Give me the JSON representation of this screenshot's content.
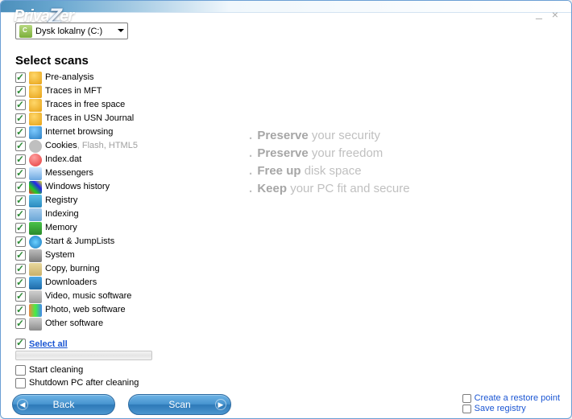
{
  "app": {
    "name": "PrivaZer"
  },
  "drive": {
    "label": "Dysk lokalny (C:)"
  },
  "section_title": "Select scans",
  "scans": [
    {
      "label": "Pre-analysis",
      "checked": true,
      "icon": "ico-shield"
    },
    {
      "label": "Traces in MFT",
      "checked": true,
      "icon": "ico-shield"
    },
    {
      "label": "Traces in free space",
      "checked": true,
      "icon": "ico-shield"
    },
    {
      "label": "Traces in USN Journal",
      "checked": true,
      "icon": "ico-shield"
    },
    {
      "label": "Internet browsing",
      "checked": true,
      "icon": "ico-globe"
    },
    {
      "label": "Cookies",
      "label_muted": ", Flash, HTML5",
      "checked": true,
      "icon": "ico-cookie"
    },
    {
      "label": "Index.dat",
      "checked": true,
      "icon": "ico-index"
    },
    {
      "label": "Messengers",
      "checked": true,
      "icon": "ico-msg"
    },
    {
      "label": "Windows history",
      "checked": true,
      "icon": "ico-win"
    },
    {
      "label": "Registry",
      "checked": true,
      "icon": "ico-reg"
    },
    {
      "label": "Indexing",
      "checked": true,
      "icon": "ico-idx"
    },
    {
      "label": "Memory",
      "checked": true,
      "icon": "ico-mem"
    },
    {
      "label": "Start & JumpLists",
      "checked": true,
      "icon": "ico-power"
    },
    {
      "label": "System",
      "checked": true,
      "icon": "ico-sys"
    },
    {
      "label": "Copy, burning",
      "checked": true,
      "icon": "ico-copy"
    },
    {
      "label": "Downloaders",
      "checked": true,
      "icon": "ico-dl"
    },
    {
      "label": "Video, music software",
      "checked": true,
      "icon": "ico-media"
    },
    {
      "label": "Photo, web software",
      "checked": true,
      "icon": "ico-photo"
    },
    {
      "label": "Other software",
      "checked": true,
      "icon": "ico-app"
    }
  ],
  "select_all": {
    "label": "Select all",
    "checked": true
  },
  "post_options": [
    {
      "label": "Start cleaning",
      "checked": false
    },
    {
      "label": "Shutdown PC after cleaning",
      "checked": false
    }
  ],
  "slogans": [
    {
      "bold": "Preserve",
      "rest": " your security"
    },
    {
      "bold": "Preserve",
      "rest": " your freedom"
    },
    {
      "bold": "Free up",
      "rest": " disk space"
    },
    {
      "bold": "Keep",
      "rest": " your PC fit and secure"
    }
  ],
  "buttons": {
    "back": "Back",
    "scan": "Scan"
  },
  "footer_opts": {
    "restore": {
      "label": "Create a restore point",
      "checked": false
    },
    "save_reg": {
      "label": "Save registry",
      "checked": false
    }
  }
}
